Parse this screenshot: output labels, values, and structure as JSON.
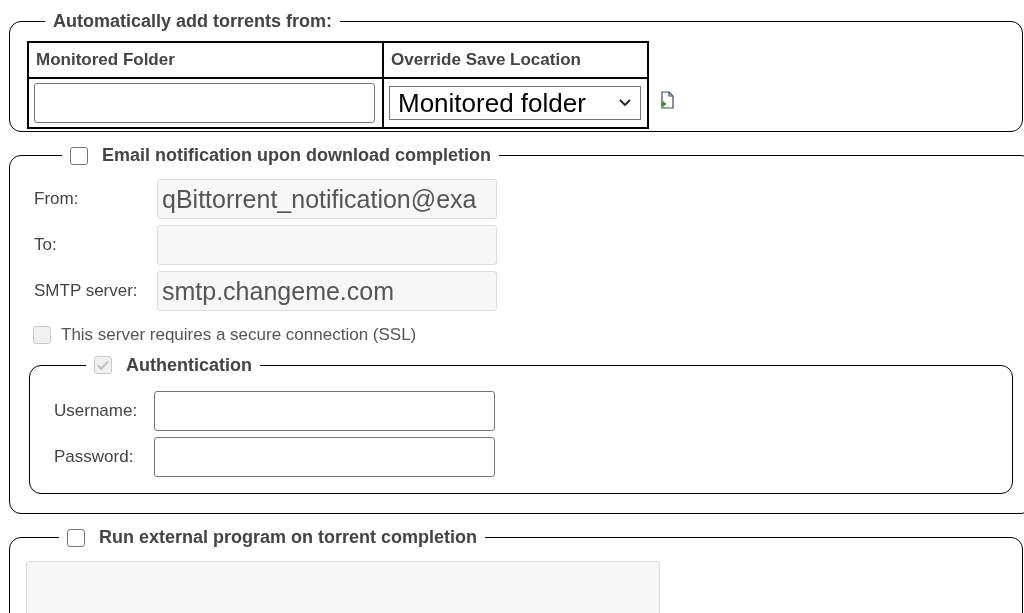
{
  "autoadd": {
    "legend": "Automatically add torrents from:",
    "columns": [
      "Monitored Folder",
      "Override Save Location"
    ],
    "rows": [
      {
        "save_location": "Monitored folder"
      }
    ]
  },
  "email": {
    "legend": "Email notification upon download completion",
    "checked": false,
    "fields": [
      {
        "label": "From:",
        "value": "qBittorrent_notification@exa",
        "disabled": true
      },
      {
        "label": "To:",
        "disabled": true
      },
      {
        "label": "SMTP server:",
        "value": "smtp.changeme.com",
        "disabled": true
      }
    ],
    "ssl": {
      "label": "This server requires a secure connection (SSL)",
      "checked": false,
      "disabled": true
    },
    "auth": {
      "legend": "Authentication",
      "checked": true,
      "disabled": true,
      "fields": [
        {
          "label": "Username:",
          "disabled": false
        },
        {
          "label": "Password:",
          "disabled": false
        }
      ]
    }
  },
  "run_program": {
    "legend": "Run external program on torrent completion",
    "checked": false
  }
}
